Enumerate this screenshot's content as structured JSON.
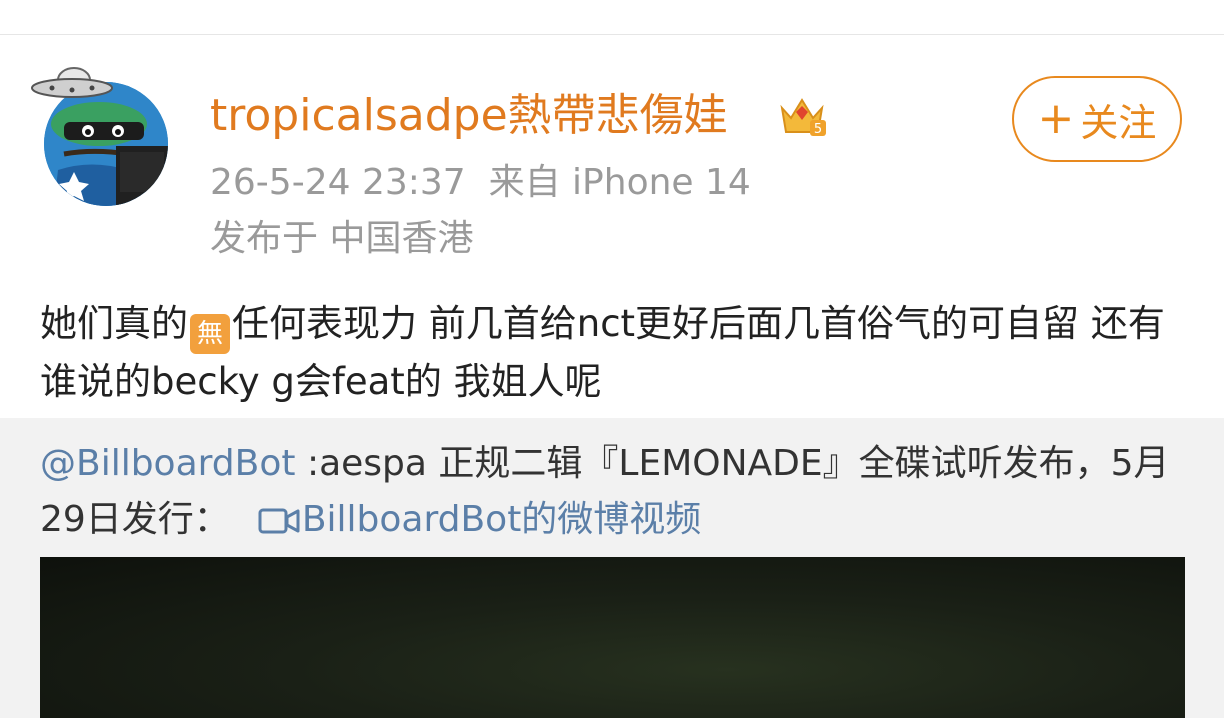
{
  "post": {
    "username": "tropicalsadpe熱帶悲傷娃",
    "timestamp": "26-5-24 23:37",
    "source": "来自 iPhone 14",
    "location": "发布于 中国香港",
    "follow_label": "关注",
    "follow_icon": "plus-icon",
    "badge_icon": "crown-icon",
    "avatar_icon": "pepe-avatar",
    "accent_color": "#e07a1f",
    "text_part1": "她们真的",
    "emoji_wu": "無",
    "text_part2": "任何表现力 前几首给nct更好后面几首俗气的可自留 还有谁说的becky g会feat的 我姐人呢"
  },
  "repost": {
    "mention": "@BillboardBot",
    "text": " :aespa 正规二辑『LEMONADE』全碟试听发布，5月29日发行：",
    "video_icon": "video-icon",
    "video_link": "BillboardBot的微博视频",
    "link_color": "#5b7fa8"
  }
}
